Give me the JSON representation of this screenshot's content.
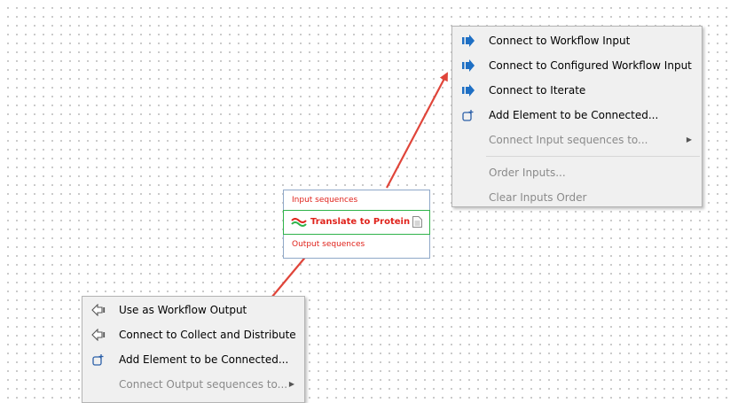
{
  "top_menu": {
    "items": [
      {
        "label": "Connect to Workflow Input",
        "icon": "blue-arrow-right-icon",
        "enabled": true
      },
      {
        "label": "Connect to Configured Workflow Input",
        "icon": "blue-arrow-right-icon",
        "enabled": true
      },
      {
        "label": "Connect to Iterate",
        "icon": "blue-arrow-right-icon",
        "enabled": true
      },
      {
        "label": "Add Element to be Connected...",
        "icon": "add-element-icon",
        "enabled": true
      },
      {
        "label": "Connect Input sequences to...",
        "enabled": false,
        "submenu": true
      },
      {
        "label": "Order Inputs...",
        "enabled": false
      },
      {
        "label": "Clear Inputs Order",
        "enabled": false
      }
    ]
  },
  "node": {
    "input_port": "Input sequences",
    "title": "Translate to Protein",
    "output_port": "Output sequences",
    "port_color": "#e0231c",
    "title_border_color": "#2fb34a"
  },
  "bottom_menu": {
    "items": [
      {
        "label": "Use as Workflow Output",
        "icon": "outline-arrow-left-icon",
        "enabled": true
      },
      {
        "label": "Connect to Collect and Distribute",
        "icon": "outline-arrow-left-icon",
        "enabled": true
      },
      {
        "label": "Add Element to be Connected...",
        "icon": "add-element-icon",
        "enabled": true
      },
      {
        "label": "Connect Output sequences to...",
        "enabled": false,
        "submenu": true
      }
    ]
  },
  "arrow_color": "#e0453a"
}
